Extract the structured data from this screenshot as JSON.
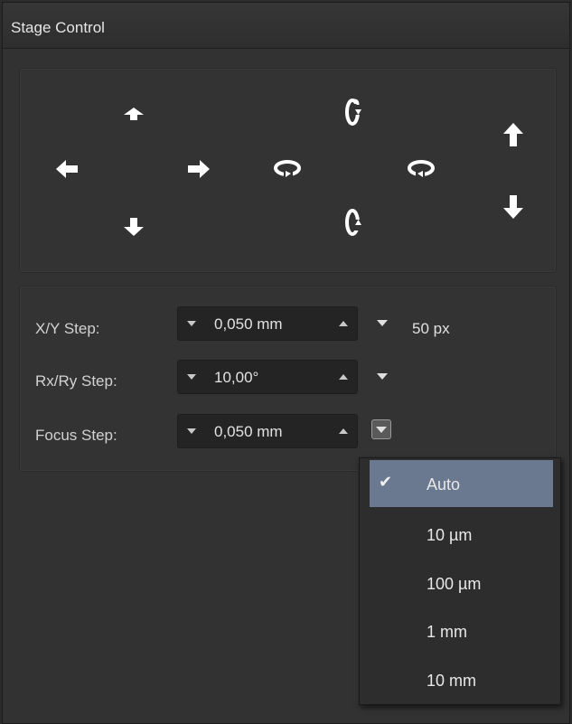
{
  "panel": {
    "title": "Stage Control"
  },
  "jog": {
    "xy_up_icon": "arrow-up-small",
    "xy_left_icon": "arrow-left",
    "xy_right_icon": "arrow-right",
    "xy_down_icon": "arrow-down",
    "rot_x_pos_icon": "rotate-vertical-up",
    "rot_x_neg_icon": "rotate-vertical-down",
    "rot_y_left_icon": "rotate-horizontal-left",
    "rot_y_right_icon": "rotate-horizontal-right",
    "focus_up_icon": "arrow-up",
    "focus_down_icon": "arrow-down"
  },
  "steps": {
    "xy": {
      "label": "X/Y Step:",
      "value": "0,050 mm",
      "extra": "50 px"
    },
    "rxry": {
      "label": "Rx/Ry Step:",
      "value": "10,00°"
    },
    "focus": {
      "label": "Focus Step:",
      "value": "0,050 mm"
    }
  },
  "menu": {
    "check": "✔",
    "items": [
      "Auto",
      "10 µm",
      "100 µm",
      "1 mm",
      "10 mm"
    ],
    "selected": "Auto"
  },
  "colors": {
    "background": "#323232",
    "selected": "#6a7890",
    "icon": "#ffffff"
  }
}
